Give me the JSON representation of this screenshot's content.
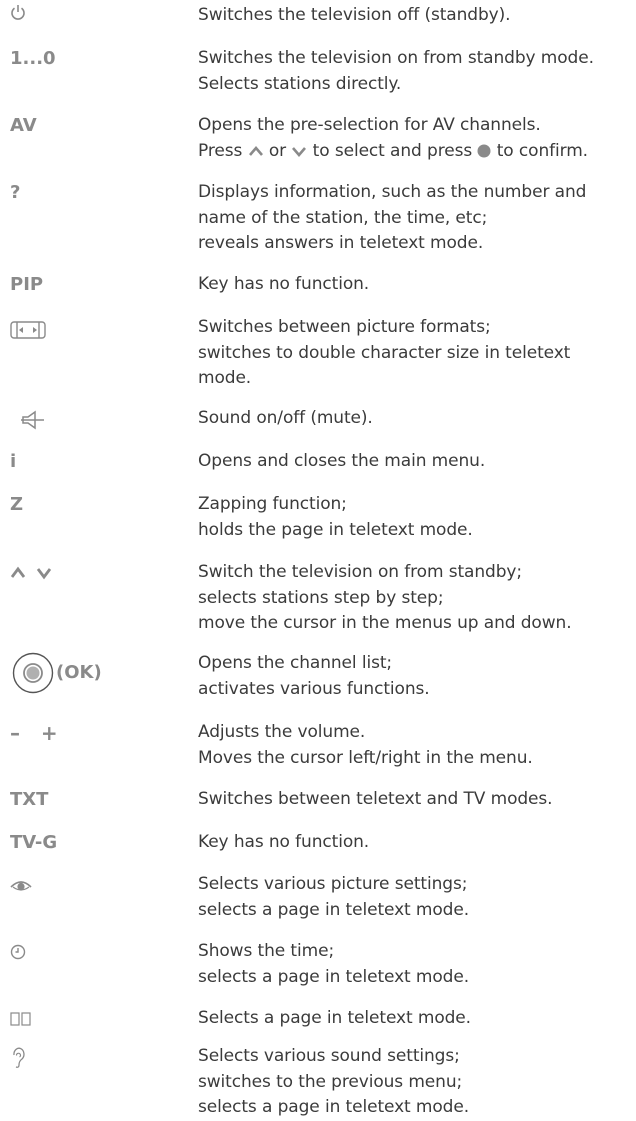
{
  "rows": [
    {
      "key": "",
      "icon": "power-icon",
      "lines": [
        "Switches the television off (standby)."
      ]
    },
    {
      "key": "1...0",
      "lines": [
        "Switches the television on from standby mode.",
        "Selects stations directly."
      ]
    },
    {
      "key": "AV",
      "lines": [
        "Opens the pre-selection for AV channels.",
        [
          "Press ",
          " or ",
          " to select and press ",
          " to confirm."
        ]
      ]
    },
    {
      "key": "?",
      "lines": [
        "Displays information, such as the number and",
        "name of the station, the time, etc;",
        "reveals answers in teletext mode."
      ]
    },
    {
      "key": "PIP",
      "lines": [
        "Key has no function."
      ]
    },
    {
      "key": "",
      "icon": "picture-format-icon",
      "lines": [
        "Switches between picture formats;",
        "switches to double character size in teletext",
        "mode."
      ]
    },
    {
      "key": "",
      "icon": "mute-icon",
      "lines": [
        "Sound on/off (mute)."
      ]
    },
    {
      "key": "i",
      "lines": [
        "Opens and closes the main menu."
      ]
    },
    {
      "key": "Z",
      "lines": [
        "Zapping function;",
        "holds the page in teletext mode."
      ]
    },
    {
      "key": "",
      "icon": "up-down-arrows-icon",
      "lines": [
        "Switch the television on from standby;",
        "selects stations step by step;",
        "move the cursor in the menus up and down."
      ]
    },
    {
      "key": "(OK)",
      "icon": "ok-button-icon",
      "lines": [
        "Opens the channel list;",
        "activates various functions."
      ]
    },
    {
      "key": "–   +",
      "lines": [
        "Adjusts the volume.",
        "Moves the cursor left/right in the menu."
      ]
    },
    {
      "key": "TXT",
      "lines": [
        "Switches between teletext and TV modes."
      ]
    },
    {
      "key": "TV-G",
      "lines": [
        "Key has no function."
      ]
    },
    {
      "key": "",
      "icon": "eye-icon",
      "lines": [
        "Selects various picture settings;",
        "selects a page in teletext mode."
      ]
    },
    {
      "key": "",
      "icon": "clock-icon",
      "lines": [
        "Shows the time;",
        "selects a page in teletext mode."
      ]
    },
    {
      "key": "",
      "icon": "split-screen-icon",
      "lines": [
        "Selects a page in teletext mode."
      ]
    },
    {
      "key": "",
      "icon": "ear-icon",
      "lines": [
        "Selects various sound settings;",
        "switches to the previous menu;",
        "selects a page in teletext mode."
      ]
    }
  ]
}
